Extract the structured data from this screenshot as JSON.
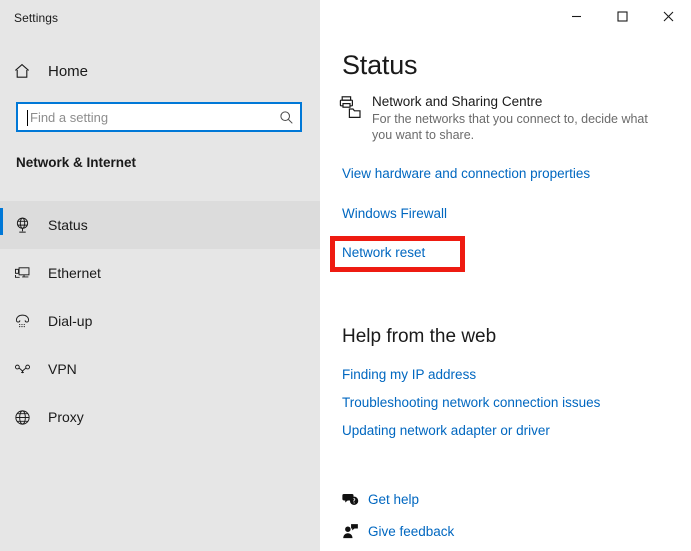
{
  "window": {
    "title": "Settings",
    "controls": [
      {
        "name": "minimize-button",
        "glyph": "minimize"
      },
      {
        "name": "maximize-button",
        "glyph": "maximize"
      },
      {
        "name": "close-button",
        "glyph": "close"
      }
    ]
  },
  "sidebar": {
    "home_label": "Home",
    "home_icon": "home-icon",
    "search": {
      "placeholder": "Find a setting",
      "value": "",
      "icon": "search-icon"
    },
    "category_heading": "Network & Internet",
    "items": [
      {
        "label": "Status",
        "icon": "network-status-icon",
        "selected": true
      },
      {
        "label": "Ethernet",
        "icon": "ethernet-icon",
        "selected": false
      },
      {
        "label": "Dial-up",
        "icon": "dialup-phone-icon",
        "selected": false
      },
      {
        "label": "VPN",
        "icon": "vpn-key-icon",
        "selected": false
      },
      {
        "label": "Proxy",
        "icon": "globe-icon",
        "selected": false
      }
    ]
  },
  "main": {
    "page_title": "Status",
    "sharing_centre": {
      "icon": "network-sharing-centre-icon",
      "title": "Network and Sharing Centre",
      "description": "For the networks that you connect to, decide what you want to share."
    },
    "links": [
      {
        "label": "View hardware and connection properties",
        "id": "view-hardware"
      },
      {
        "label": "Windows Firewall",
        "id": "windows-firewall"
      },
      {
        "label": "Network reset",
        "id": "network-reset",
        "highlighted": true
      }
    ],
    "help_section": {
      "heading": "Help from the web",
      "links": [
        "Finding my IP address",
        "Troubleshooting network connection issues",
        "Updating network adapter or driver"
      ]
    },
    "footer": [
      {
        "label": "Get help",
        "icon": "help-question-bubble-icon"
      },
      {
        "label": "Give feedback",
        "icon": "feedback-person-icon"
      }
    ]
  },
  "colors": {
    "accent": "#0078d7",
    "link": "#0067c0",
    "highlight": "#ee1b11",
    "sidebar_bg": "#e6e6e6",
    "content_bg": "#ffffff"
  }
}
